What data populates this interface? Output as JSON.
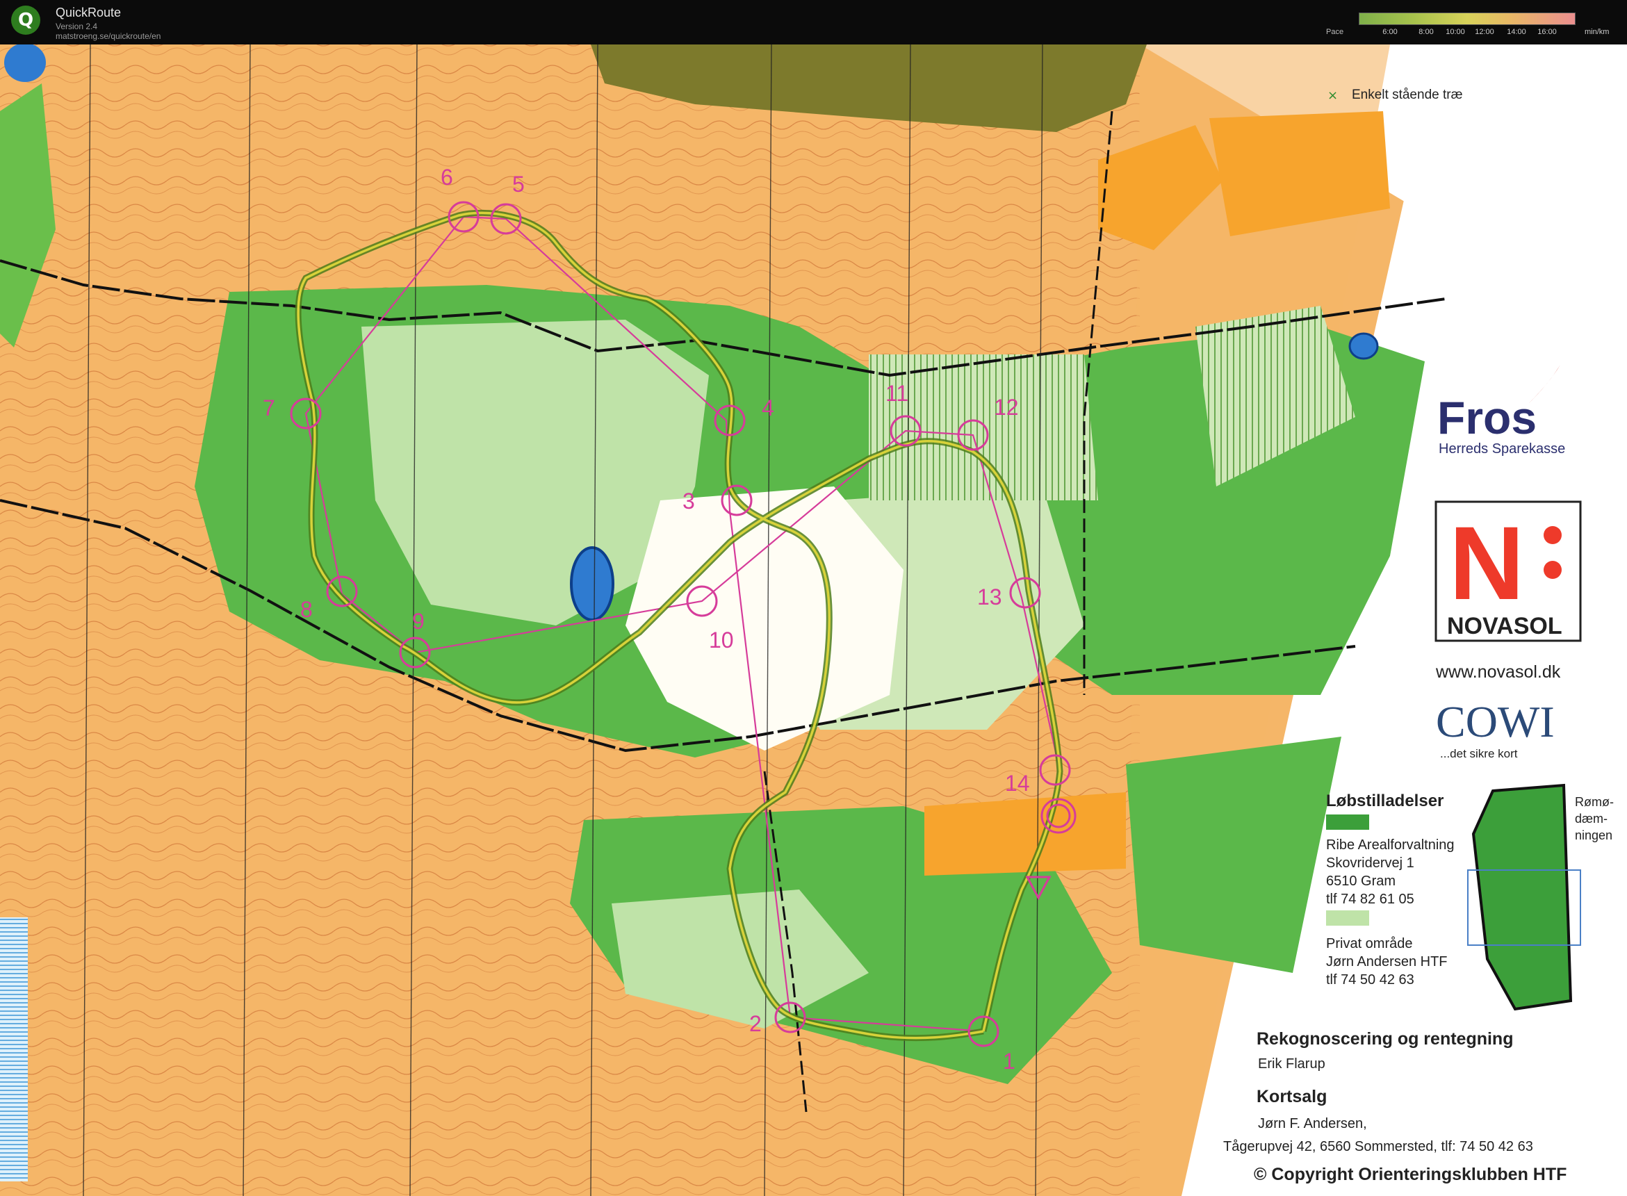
{
  "app": {
    "name": "QuickRoute",
    "version": "Version 2.4",
    "url": "matstroeng.se/quickroute/en",
    "logo_letter": "Q"
  },
  "pace_legend": {
    "label": "Pace",
    "ticks": [
      "6:00",
      "8:00",
      "10:00",
      "12:00",
      "14:00",
      "16:00"
    ],
    "unit": "min/km"
  },
  "map": {
    "legend_note": "Enkelt stående træ",
    "sponsor1": {
      "name": "Fros",
      "subtitle": "Herreds Sparekasse"
    },
    "sponsor2": {
      "name": "NOVASOL",
      "url": "www.novasol.dk"
    },
    "sponsor3": {
      "name": "COWI",
      "tagline": "...det sikre kort"
    },
    "permits": {
      "title": "Løbstilladelser",
      "entry1": [
        "Ribe Arealforvaltning",
        "Skovridervej 1",
        "6510 Gram",
        "tlf 74 82 61 05"
      ],
      "entry2": [
        "Privat område",
        "Jørn Andersen HTF",
        "tlf 74 50 42 63"
      ]
    },
    "inset_label": [
      "Rømø-",
      "dæm-",
      "ningen"
    ],
    "survey": {
      "title": "Rekognoscering og rentegning",
      "name": "Erik Flarup"
    },
    "sales": {
      "title": "Kortsalg",
      "lines": [
        "Jørn F. Andersen,",
        "Tågerupvej 42, 6560 Sommersted, tlf: 74 50 42 63"
      ]
    },
    "copyright": "© Copyright Orienteringsklubben HTF",
    "controls": [
      "1",
      "2",
      "3",
      "4",
      "5",
      "6",
      "7",
      "8",
      "9",
      "10",
      "11",
      "12",
      "13",
      "14"
    ],
    "colors": {
      "open": "#f5b668",
      "forest": "#5bb84a",
      "lightgreen": "#bfe3a8",
      "course": "#d63c9a",
      "track": "#9bb832",
      "brown": "#c4632a"
    }
  }
}
